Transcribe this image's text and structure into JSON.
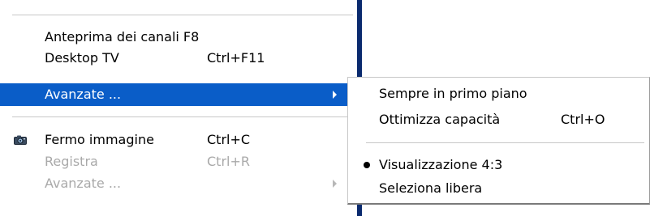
{
  "main_menu": {
    "items": [
      {
        "label": "Anteprima dei canali F8",
        "shortcut": ""
      },
      {
        "label": "Desktop TV",
        "shortcut": "Ctrl+F11"
      },
      {
        "label": "Avanzate ...",
        "shortcut": "",
        "has_submenu": true,
        "state": "selected"
      },
      {
        "label": "Fermo immagine",
        "shortcut": "Ctrl+C",
        "icon": "camera-icon"
      },
      {
        "label": "Registra",
        "shortcut": "Ctrl+R",
        "state": "disabled"
      },
      {
        "label": "Avanzate ...",
        "shortcut": "",
        "has_submenu": true,
        "state": "disabled"
      }
    ]
  },
  "sub_menu": {
    "items": [
      {
        "label": "Sempre in primo piano",
        "shortcut": ""
      },
      {
        "label": "Ottimizza capacità",
        "shortcut": "Ctrl+O"
      },
      {
        "label": "Visualizzazione 4:3",
        "shortcut": "",
        "checked": true,
        "indicator": "radio-dot"
      },
      {
        "label": "Seleziona libera",
        "shortcut": ""
      }
    ]
  },
  "colors": {
    "selection_bg": "#0a5dc8",
    "selection_text": "#ffffff",
    "disabled_text": "#a9a9a9",
    "backdrop_edge": "#0a2a6e"
  }
}
